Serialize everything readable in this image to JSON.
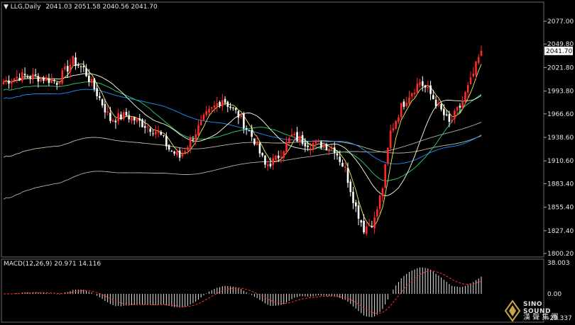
{
  "header": {
    "symbol": "LLG,Daily",
    "ohlc": "2041.03 2051.58 2040.56 2041.70"
  },
  "price_axis": {
    "ticks": [
      "2077.00",
      "2049.80",
      "2021.80",
      "1993.80",
      "1966.60",
      "1938.60",
      "1910.60",
      "1883.40",
      "1855.40",
      "1827.40",
      "1800.20"
    ],
    "current_price": "2041.70"
  },
  "macd": {
    "label": "MACD(12,26,9) 20.971 14.116",
    "ticks": [
      "38.003",
      "0.00",
      "-29.337"
    ]
  },
  "logo": {
    "text": "SINO SOUND",
    "subtext": "漢 聲 集 團"
  },
  "colors": {
    "background": "#000000",
    "up_candle": "#ff2a2a",
    "down_candle": "#ffffff",
    "ma5": "#f0f060",
    "ma20": "#ffffe0",
    "ma30": "#30d070",
    "ma60": "#2090ff",
    "ma120": "#c0c0a0",
    "ma240": "#b0b0b0",
    "macd_hist": "#e6e6e6",
    "macd_signal": "#ff3030"
  },
  "chart_data": {
    "type": "candlestick",
    "title": "LLG,Daily",
    "ylim": [
      1800.2,
      2077.0
    ],
    "macd_ylim": [
      -29.337,
      38.003
    ],
    "macd_value": 20.971,
    "macd_signal_value": 14.116
  }
}
